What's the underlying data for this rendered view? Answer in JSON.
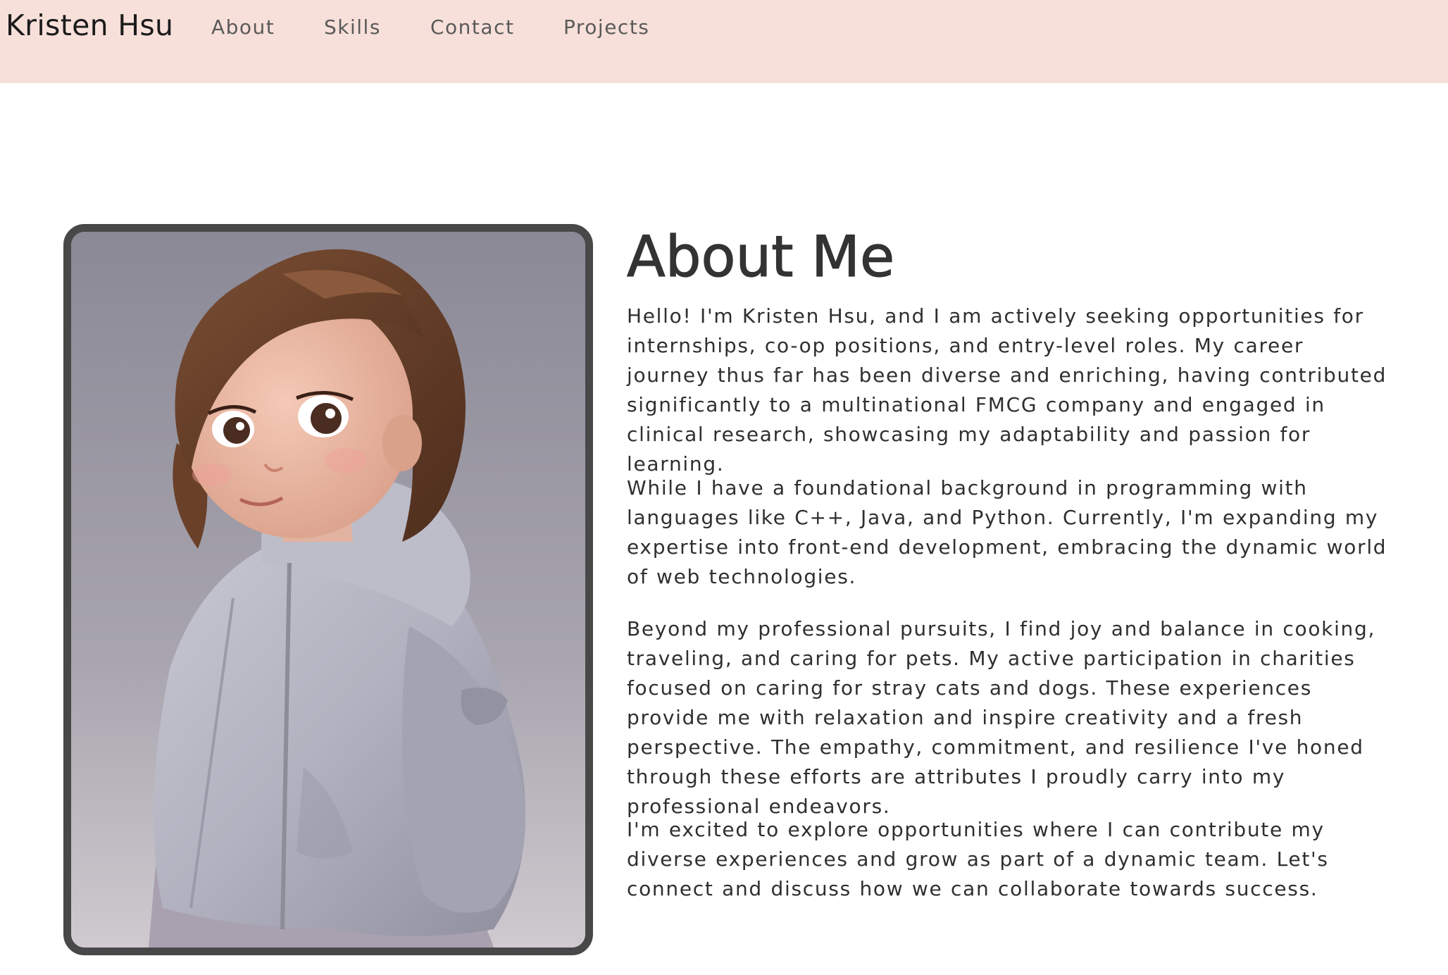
{
  "nav": {
    "brand": "Kristen Hsu",
    "links": [
      "About",
      "Skills",
      "Contact",
      "Projects"
    ]
  },
  "about": {
    "title": "About Me",
    "paragraphs": [
      "Hello! I'm Kristen Hsu, and I am actively seeking opportunities for internships, co-op positions, and entry-level roles. My career journey thus far has been diverse and enriching, having contributed significantly to a multinational FMCG company and engaged in clinical research, showcasing my adaptability and passion for learning.",
      "While I have a foundational background in programming with languages like C++, Java, and Python. Currently, I'm expanding my expertise into front-end development, embracing the dynamic world of web technologies.",
      "Beyond my professional pursuits, I find joy and balance in cooking, traveling, and caring for pets. My active participation in charities focused on caring for stray cats and dogs. These experiences provide me with relaxation and inspire creativity and a fresh perspective. The empathy, commitment, and resilience I've honed through these efforts are attributes I proudly carry into my professional endeavors.",
      "I'm excited to explore opportunities where I can contribute my diverse experiences and grow as part of a dynamic team. Let's connect and discuss how we can collaborate towards success."
    ]
  },
  "colors": {
    "navbar_bg": "#f8e0da",
    "frame_border": "#484848",
    "text": "#333333"
  }
}
